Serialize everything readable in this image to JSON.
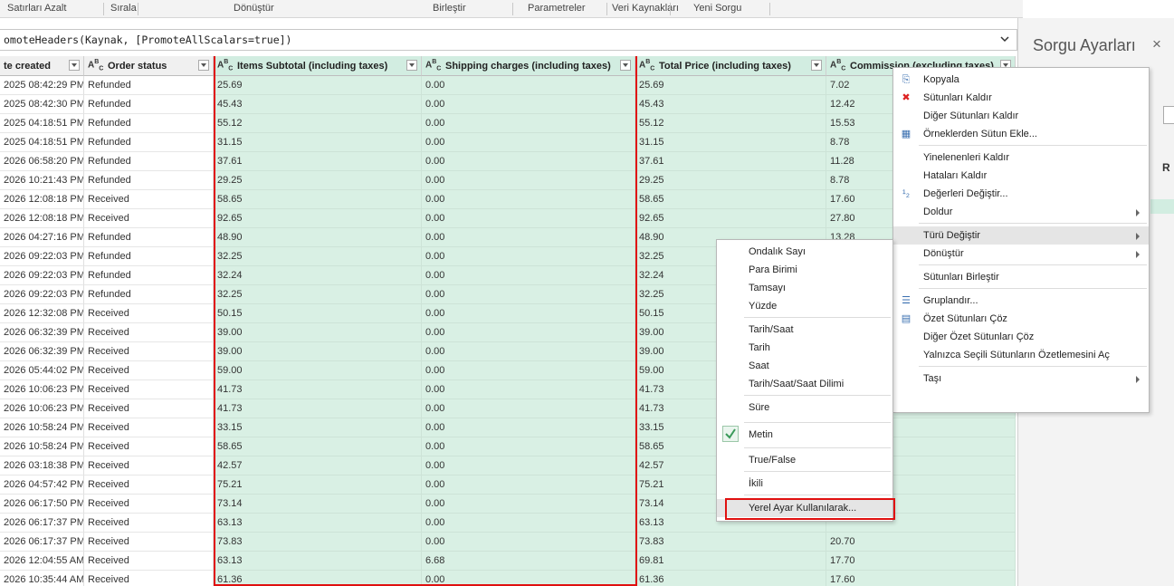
{
  "ribbon": {
    "groups": [
      {
        "label": "Satırları Azalt"
      },
      {
        "label": "Sırala"
      },
      {
        "label": "Dönüştür"
      },
      {
        "label": "Birleştir"
      },
      {
        "label": "Parametreler"
      },
      {
        "label": "Veri Kaynakları"
      },
      {
        "label": "Yeni Sorgu"
      }
    ]
  },
  "formula": {
    "text": "omoteHeaders(Kaynak, [PromoteAllScalars=true])",
    "expand_icon": "chevron-down-icon"
  },
  "table": {
    "columns": [
      {
        "label": "te created",
        "type": ""
      },
      {
        "label": "Order status",
        "type": "ABC"
      },
      {
        "label": "Items Subtotal (including taxes)",
        "type": "ABC"
      },
      {
        "label": "Shipping charges (including taxes)",
        "type": "ABC"
      },
      {
        "label": "Total Price (including taxes)",
        "type": "ABC"
      },
      {
        "label": "Commission (excluding taxes)",
        "type": "ABC"
      }
    ],
    "rows": [
      [
        "2025 08:42:29 PM",
        "Refunded",
        "25.69",
        "0.00",
        "25.69",
        "7.02"
      ],
      [
        "2025 08:42:30 PM",
        "Refunded",
        "45.43",
        "0.00",
        "45.43",
        "12.42"
      ],
      [
        "2025 04:18:51 PM",
        "Refunded",
        "55.12",
        "0.00",
        "55.12",
        "15.53"
      ],
      [
        "2025 04:18:51 PM",
        "Refunded",
        "31.15",
        "0.00",
        "31.15",
        "8.78"
      ],
      [
        "2026 06:58:20 PM",
        "Refunded",
        "37.61",
        "0.00",
        "37.61",
        "11.28"
      ],
      [
        "2026 10:21:43 PM",
        "Refunded",
        "29.25",
        "0.00",
        "29.25",
        "8.78"
      ],
      [
        "2026 12:08:18 PM",
        "Received",
        "58.65",
        "0.00",
        "58.65",
        "17.60"
      ],
      [
        "2026 12:08:18 PM",
        "Received",
        "92.65",
        "0.00",
        "92.65",
        "27.80"
      ],
      [
        "2026 04:27:16 PM",
        "Refunded",
        "48.90",
        "0.00",
        "48.90",
        "13.28"
      ],
      [
        "2026 09:22:03 PM",
        "Refunded",
        "32.25",
        "0.00",
        "32.25",
        ""
      ],
      [
        "2026 09:22:03 PM",
        "Refunded",
        "32.24",
        "0.00",
        "32.24",
        ""
      ],
      [
        "2026 09:22:03 PM",
        "Refunded",
        "32.25",
        "0.00",
        "32.25",
        ""
      ],
      [
        "2026 12:32:08 PM",
        "Received",
        "50.15",
        "0.00",
        "50.15",
        ""
      ],
      [
        "2026 06:32:39 PM",
        "Received",
        "39.00",
        "0.00",
        "39.00",
        ""
      ],
      [
        "2026 06:32:39 PM",
        "Received",
        "39.00",
        "0.00",
        "39.00",
        ""
      ],
      [
        "2026 05:44:02 PM",
        "Received",
        "59.00",
        "0.00",
        "59.00",
        ""
      ],
      [
        "2026 10:06:23 PM",
        "Received",
        "41.73",
        "0.00",
        "41.73",
        ""
      ],
      [
        "2026 10:06:23 PM",
        "Received",
        "41.73",
        "0.00",
        "41.73",
        ""
      ],
      [
        "2026 10:58:24 PM",
        "Received",
        "33.15",
        "0.00",
        "33.15",
        ""
      ],
      [
        "2026 10:58:24 PM",
        "Received",
        "58.65",
        "0.00",
        "58.65",
        ""
      ],
      [
        "2026 03:18:38 PM",
        "Received",
        "42.57",
        "0.00",
        "42.57",
        ""
      ],
      [
        "2026 04:57:42 PM",
        "Received",
        "75.21",
        "0.00",
        "75.21",
        ""
      ],
      [
        "2026 06:17:50 PM",
        "Received",
        "73.14",
        "0.00",
        "73.14",
        ""
      ],
      [
        "2026 06:17:37 PM",
        "Received",
        "63.13",
        "0.00",
        "63.13",
        ""
      ],
      [
        "2026 06:17:37 PM",
        "Received",
        "73.83",
        "0.00",
        "73.83",
        "20.70"
      ],
      [
        "2026 12:04:55 AM",
        "Received",
        "63.13",
        "6.68",
        "69.81",
        "17.70"
      ],
      [
        "2026 10:35:44 AM",
        "Received",
        "61.36",
        "0.00",
        "61.36",
        "17.60"
      ],
      [
        "2026 10:35:44 AM",
        "Received",
        "61.36",
        "0.00",
        "61.36",
        "17.60"
      ]
    ]
  },
  "pane": {
    "title": "Sorgu Ayarları",
    "close": "×",
    "letter": "R"
  },
  "context_menu": {
    "items": [
      {
        "label": "Kopyala",
        "icon": "copy-icon",
        "arrow": false
      },
      {
        "label": "Sütunları Kaldır",
        "icon": "remove-columns-icon",
        "arrow": false
      },
      {
        "label": "Diğer Sütunları Kaldır",
        "icon": "",
        "arrow": false
      },
      {
        "label": "Örneklerden Sütun Ekle...",
        "icon": "column-from-examples-icon",
        "arrow": false
      },
      {
        "label": "Yinelenenleri Kaldır",
        "icon": "",
        "arrow": false
      },
      {
        "label": "Hataları Kaldır",
        "icon": "",
        "arrow": false
      },
      {
        "label": "Değerleri Değiştir...",
        "icon": "replace-values-icon",
        "arrow": false
      },
      {
        "label": "Doldur",
        "icon": "",
        "arrow": true
      },
      {
        "label": "Türü Değiştir",
        "icon": "",
        "arrow": true
      },
      {
        "label": "Dönüştür",
        "icon": "",
        "arrow": true
      },
      {
        "label": "Sütunları Birleştir",
        "icon": "",
        "arrow": false
      },
      {
        "label": "Gruplandır...",
        "icon": "group-by-icon",
        "arrow": false
      },
      {
        "label": "Özet Sütunları Çöz",
        "icon": "unpivot-icon",
        "arrow": false
      },
      {
        "label": "Diğer Özet Sütunları Çöz",
        "icon": "",
        "arrow": false
      },
      {
        "label": "Yalnızca Seçili Sütunların Özetlemesini Aç",
        "icon": "",
        "arrow": false
      },
      {
        "label": "Taşı",
        "icon": "",
        "arrow": true
      }
    ]
  },
  "type_submenu": {
    "items": [
      {
        "label": "Ondalık Sayı"
      },
      {
        "label": "Para Birimi"
      },
      {
        "label": "Tamsayı"
      },
      {
        "label": "Yüzde"
      },
      {
        "label": "Tarih/Saat"
      },
      {
        "label": "Tarih"
      },
      {
        "label": "Saat"
      },
      {
        "label": "Tarih/Saat/Saat Dilimi"
      },
      {
        "label": "Süre"
      },
      {
        "label": "Metin",
        "checked": true
      },
      {
        "label": "True/False"
      },
      {
        "label": "İkili"
      },
      {
        "label": "Yerel Ayar Kullanılarak..."
      }
    ]
  },
  "colors": {
    "selected_column": "#d9f0e4",
    "highlight_box": "#e01010",
    "check": "#3a9a5a"
  }
}
